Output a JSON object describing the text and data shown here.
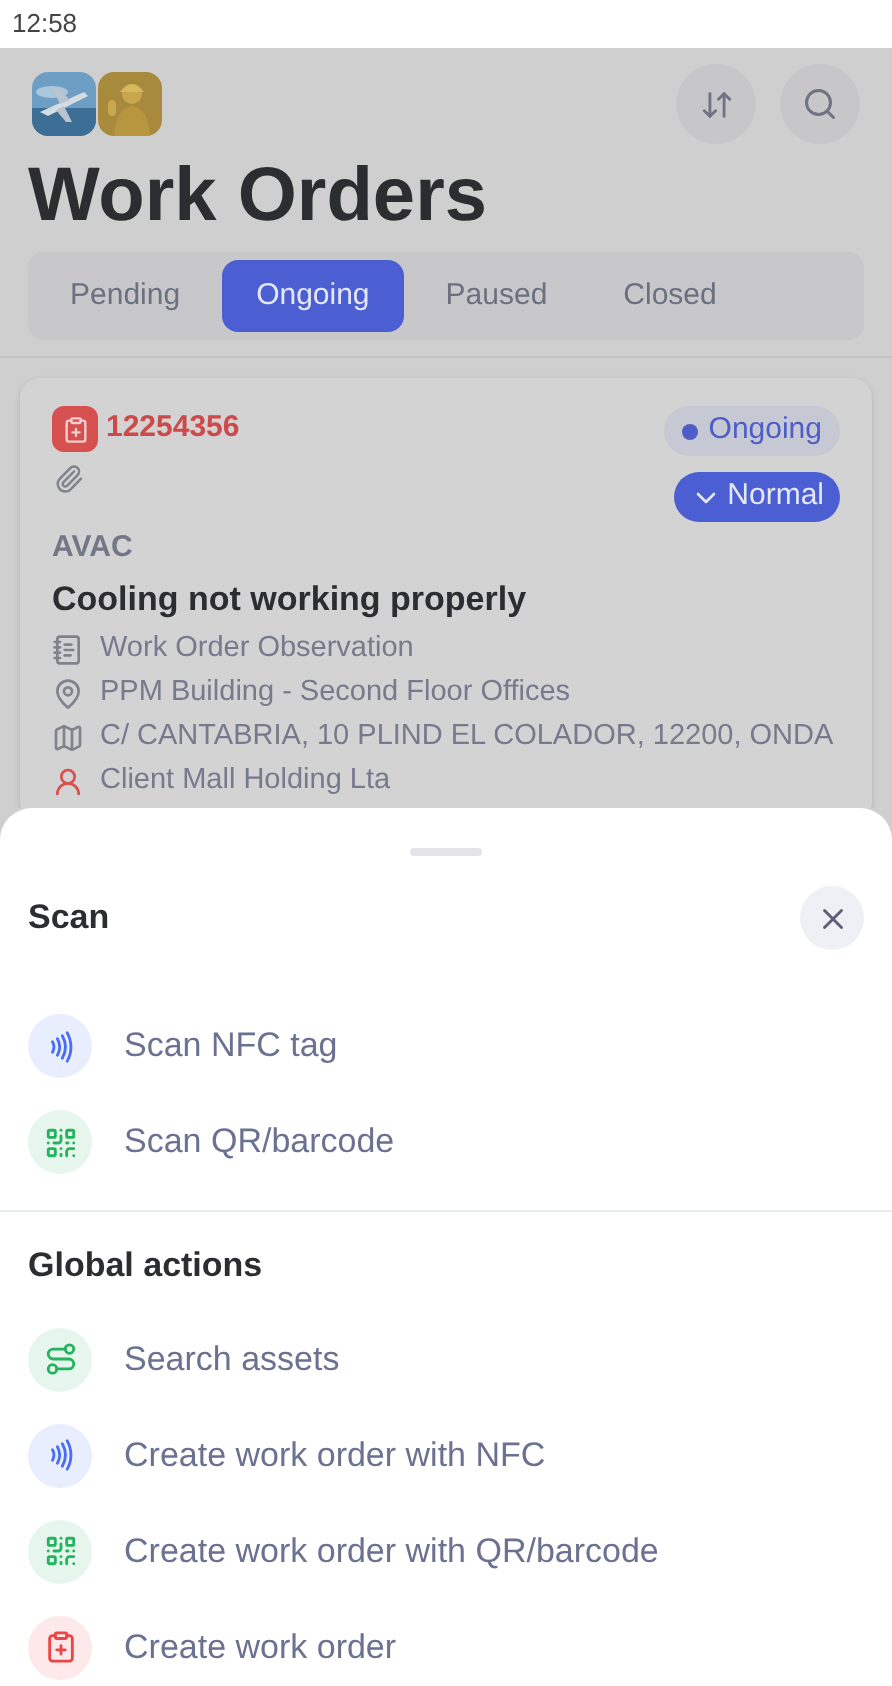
{
  "status_bar": {
    "time": "12:58"
  },
  "header": {
    "title": "Work Orders"
  },
  "tabs": [
    {
      "label": "Pending",
      "selected": false
    },
    {
      "label": "Ongoing",
      "selected": true
    },
    {
      "label": "Paused",
      "selected": false
    },
    {
      "label": "Closed",
      "selected": false
    }
  ],
  "work_order": {
    "number": "12254356",
    "status": "Ongoing",
    "priority": "Normal",
    "category": "AVAC",
    "title": "Cooling not working properly",
    "details": [
      {
        "kind": "observation",
        "text": "Work Order Observation"
      },
      {
        "kind": "location",
        "text": "PPM Building - Second Floor Offices"
      },
      {
        "kind": "address",
        "text": "C/ CANTABRIA, 10 PLIND EL COLADOR, 12200, ONDA"
      },
      {
        "kind": "client",
        "text": "Client Mall Holding Lta"
      }
    ]
  },
  "sheet": {
    "title": "Scan",
    "sections": [
      {
        "items": [
          {
            "kind": "nfc",
            "label": "Scan NFC tag"
          },
          {
            "kind": "qr",
            "label": "Scan QR/barcode"
          }
        ]
      },
      {
        "title": "Global actions",
        "items": [
          {
            "kind": "assets",
            "label": "Search assets"
          },
          {
            "kind": "nfc",
            "label": "Create work order with NFC"
          },
          {
            "kind": "qr",
            "label": "Create work order with QR/barcode"
          },
          {
            "kind": "create",
            "label": "Create work order"
          }
        ]
      }
    ]
  }
}
